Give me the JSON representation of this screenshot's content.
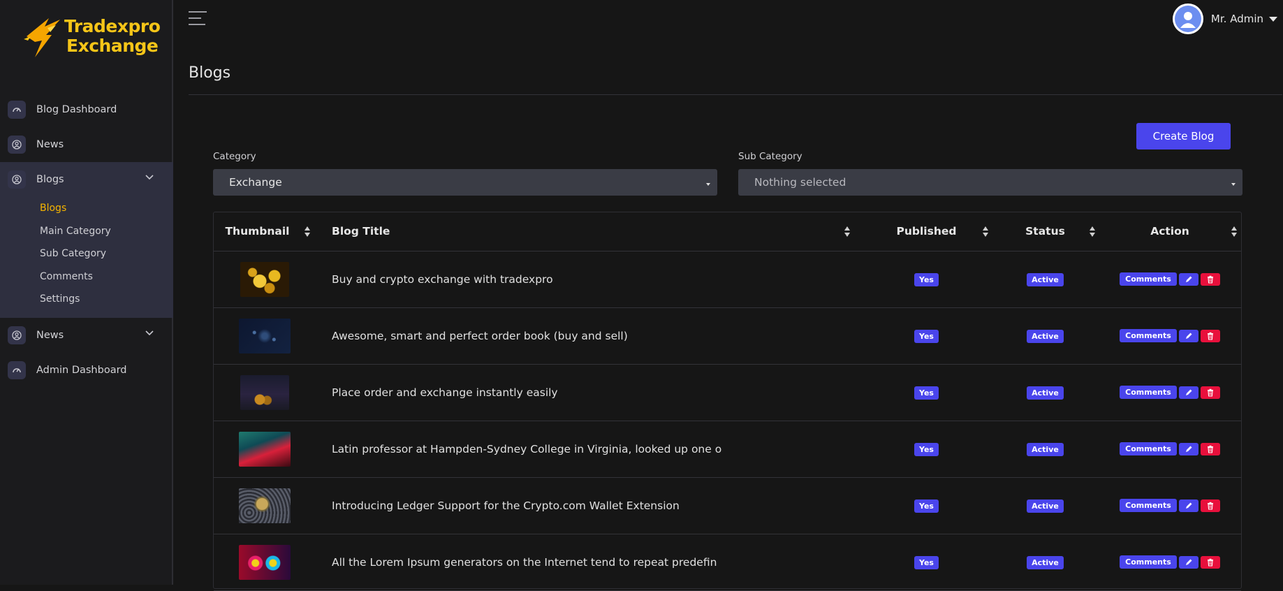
{
  "brand": {
    "line1": "Tradexpro",
    "line2": "Exchange"
  },
  "colors": {
    "accent": "#4a45ec",
    "danger": "#e8103c",
    "brand_yellow": "#f5c518",
    "active_nav": "#f5b400"
  },
  "sidebar": {
    "items": [
      {
        "label": "Blog Dashboard",
        "icon": "speedometer-icon"
      },
      {
        "label": "News",
        "icon": "user-circle-icon"
      },
      {
        "label": "Blogs",
        "icon": "user-circle-icon"
      },
      {
        "label": "News",
        "icon": "user-circle-icon"
      },
      {
        "label": "Admin Dashboard",
        "icon": "speedometer-icon"
      }
    ],
    "blogs_sub": [
      "Blogs",
      "Main Category",
      "Sub Category",
      "Comments",
      "Settings"
    ]
  },
  "header": {
    "user_name": "Mr. Admin"
  },
  "page": {
    "title": "Blogs",
    "create_button": "Create Blog"
  },
  "filters": {
    "category_label": "Category",
    "category_value": "Exchange",
    "subcategory_label": "Sub Category",
    "subcategory_value": "Nothing selected"
  },
  "table": {
    "columns": [
      "Thumbnail",
      "Blog Title",
      "Published",
      "Status",
      "Action"
    ],
    "rows": [
      {
        "title": "Buy and crypto exchange with tradexpro",
        "published": "Yes",
        "status": "Active",
        "thumb": "gold-coins"
      },
      {
        "title": "Awesome, smart and perfect order book (buy and sell)",
        "published": "Yes",
        "status": "Active",
        "thumb": "network"
      },
      {
        "title": "Place order and exchange instantly easily",
        "published": "Yes",
        "status": "Active",
        "thumb": "chart-coin"
      },
      {
        "title": "Latin professor at Hampden-Sydney College in Virginia, looked up one o",
        "published": "Yes",
        "status": "Active",
        "thumb": "laptop"
      },
      {
        "title": "Introducing Ledger Support for the Crypto.com Wallet Extension",
        "published": "Yes",
        "status": "Active",
        "thumb": "bitcoin"
      },
      {
        "title": "All the Lorem Ipsum generators on the Internet tend to repeat predefin",
        "published": "Yes",
        "status": "Active",
        "thumb": "infinity"
      }
    ],
    "comments_label": "Comments"
  }
}
